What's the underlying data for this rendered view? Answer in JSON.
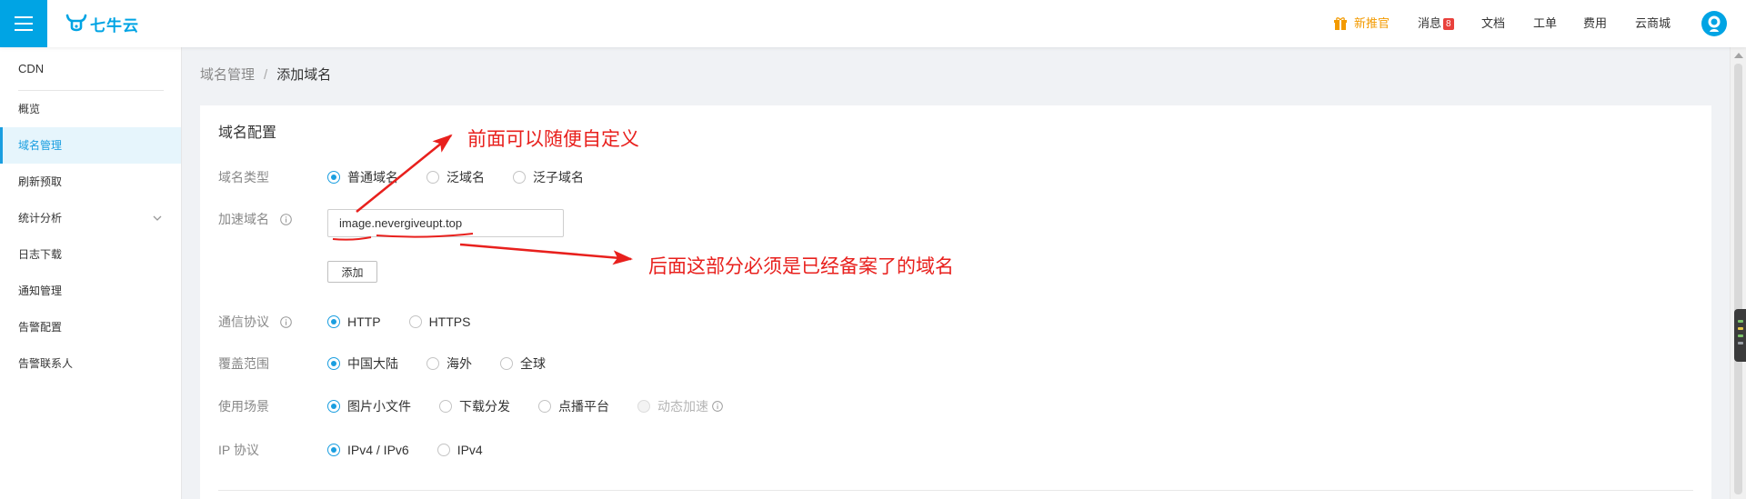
{
  "colors": {
    "brand": "#00a4e4",
    "accent": "#1a9ee0",
    "annotation": "#e8201d",
    "highlight": "#f39a00",
    "badge": "#e9413c"
  },
  "topbar": {
    "menu_icon": "menu-icon",
    "logo_text": "七牛云",
    "logo_icon": "qiniu-logo-icon",
    "nav": {
      "promo": {
        "label": "新推官",
        "icon": "gift-icon"
      },
      "messages": {
        "label": "消息",
        "badge": "8"
      },
      "docs": {
        "label": "文档"
      },
      "tickets": {
        "label": "工单"
      },
      "billing": {
        "label": "费用"
      },
      "marketplace": {
        "label": "云商城"
      }
    },
    "avatar_icon": "avatar-icon"
  },
  "sidebar": {
    "title": "CDN",
    "items": [
      {
        "label": "概览"
      },
      {
        "label": "域名管理",
        "active": true
      },
      {
        "label": "刷新预取"
      },
      {
        "label": "统计分析",
        "expandable": true
      },
      {
        "label": "日志下载"
      },
      {
        "label": "通知管理"
      },
      {
        "label": "告警配置"
      },
      {
        "label": "告警联系人"
      }
    ]
  },
  "breadcrumb": {
    "parent": "域名管理",
    "separator": "/",
    "current": "添加域名"
  },
  "form": {
    "title": "域名配置",
    "domain_type": {
      "label": "域名类型",
      "options": [
        {
          "label": "普通域名",
          "checked": true
        },
        {
          "label": "泛域名",
          "checked": false
        },
        {
          "label": "泛子域名",
          "checked": false
        }
      ]
    },
    "accel_domain": {
      "label": "加速域名",
      "value": "image.nevergiveupt.top",
      "add_label": "添加"
    },
    "protocol": {
      "label": "通信协议",
      "options": [
        {
          "label": "HTTP",
          "checked": true
        },
        {
          "label": "HTTPS",
          "checked": false
        }
      ]
    },
    "coverage": {
      "label": "覆盖范围",
      "options": [
        {
          "label": "中国大陆",
          "checked": true
        },
        {
          "label": "海外",
          "checked": false
        },
        {
          "label": "全球",
          "checked": false
        }
      ]
    },
    "scenario": {
      "label": "使用场景",
      "options": [
        {
          "label": "图片小文件",
          "checked": true
        },
        {
          "label": "下载分发",
          "checked": false
        },
        {
          "label": "点播平台",
          "checked": false
        },
        {
          "label": "动态加速",
          "checked": false,
          "disabled": true
        }
      ]
    },
    "ip_protocol": {
      "label": "IP 协议",
      "options": [
        {
          "label": "IPv4 / IPv6",
          "checked": true
        },
        {
          "label": "IPv4",
          "checked": false
        }
      ]
    }
  },
  "annotations": {
    "prefix_note": "前面可以随便自定义",
    "suffix_note": "后面这部分必须是已经备案了的域名"
  }
}
